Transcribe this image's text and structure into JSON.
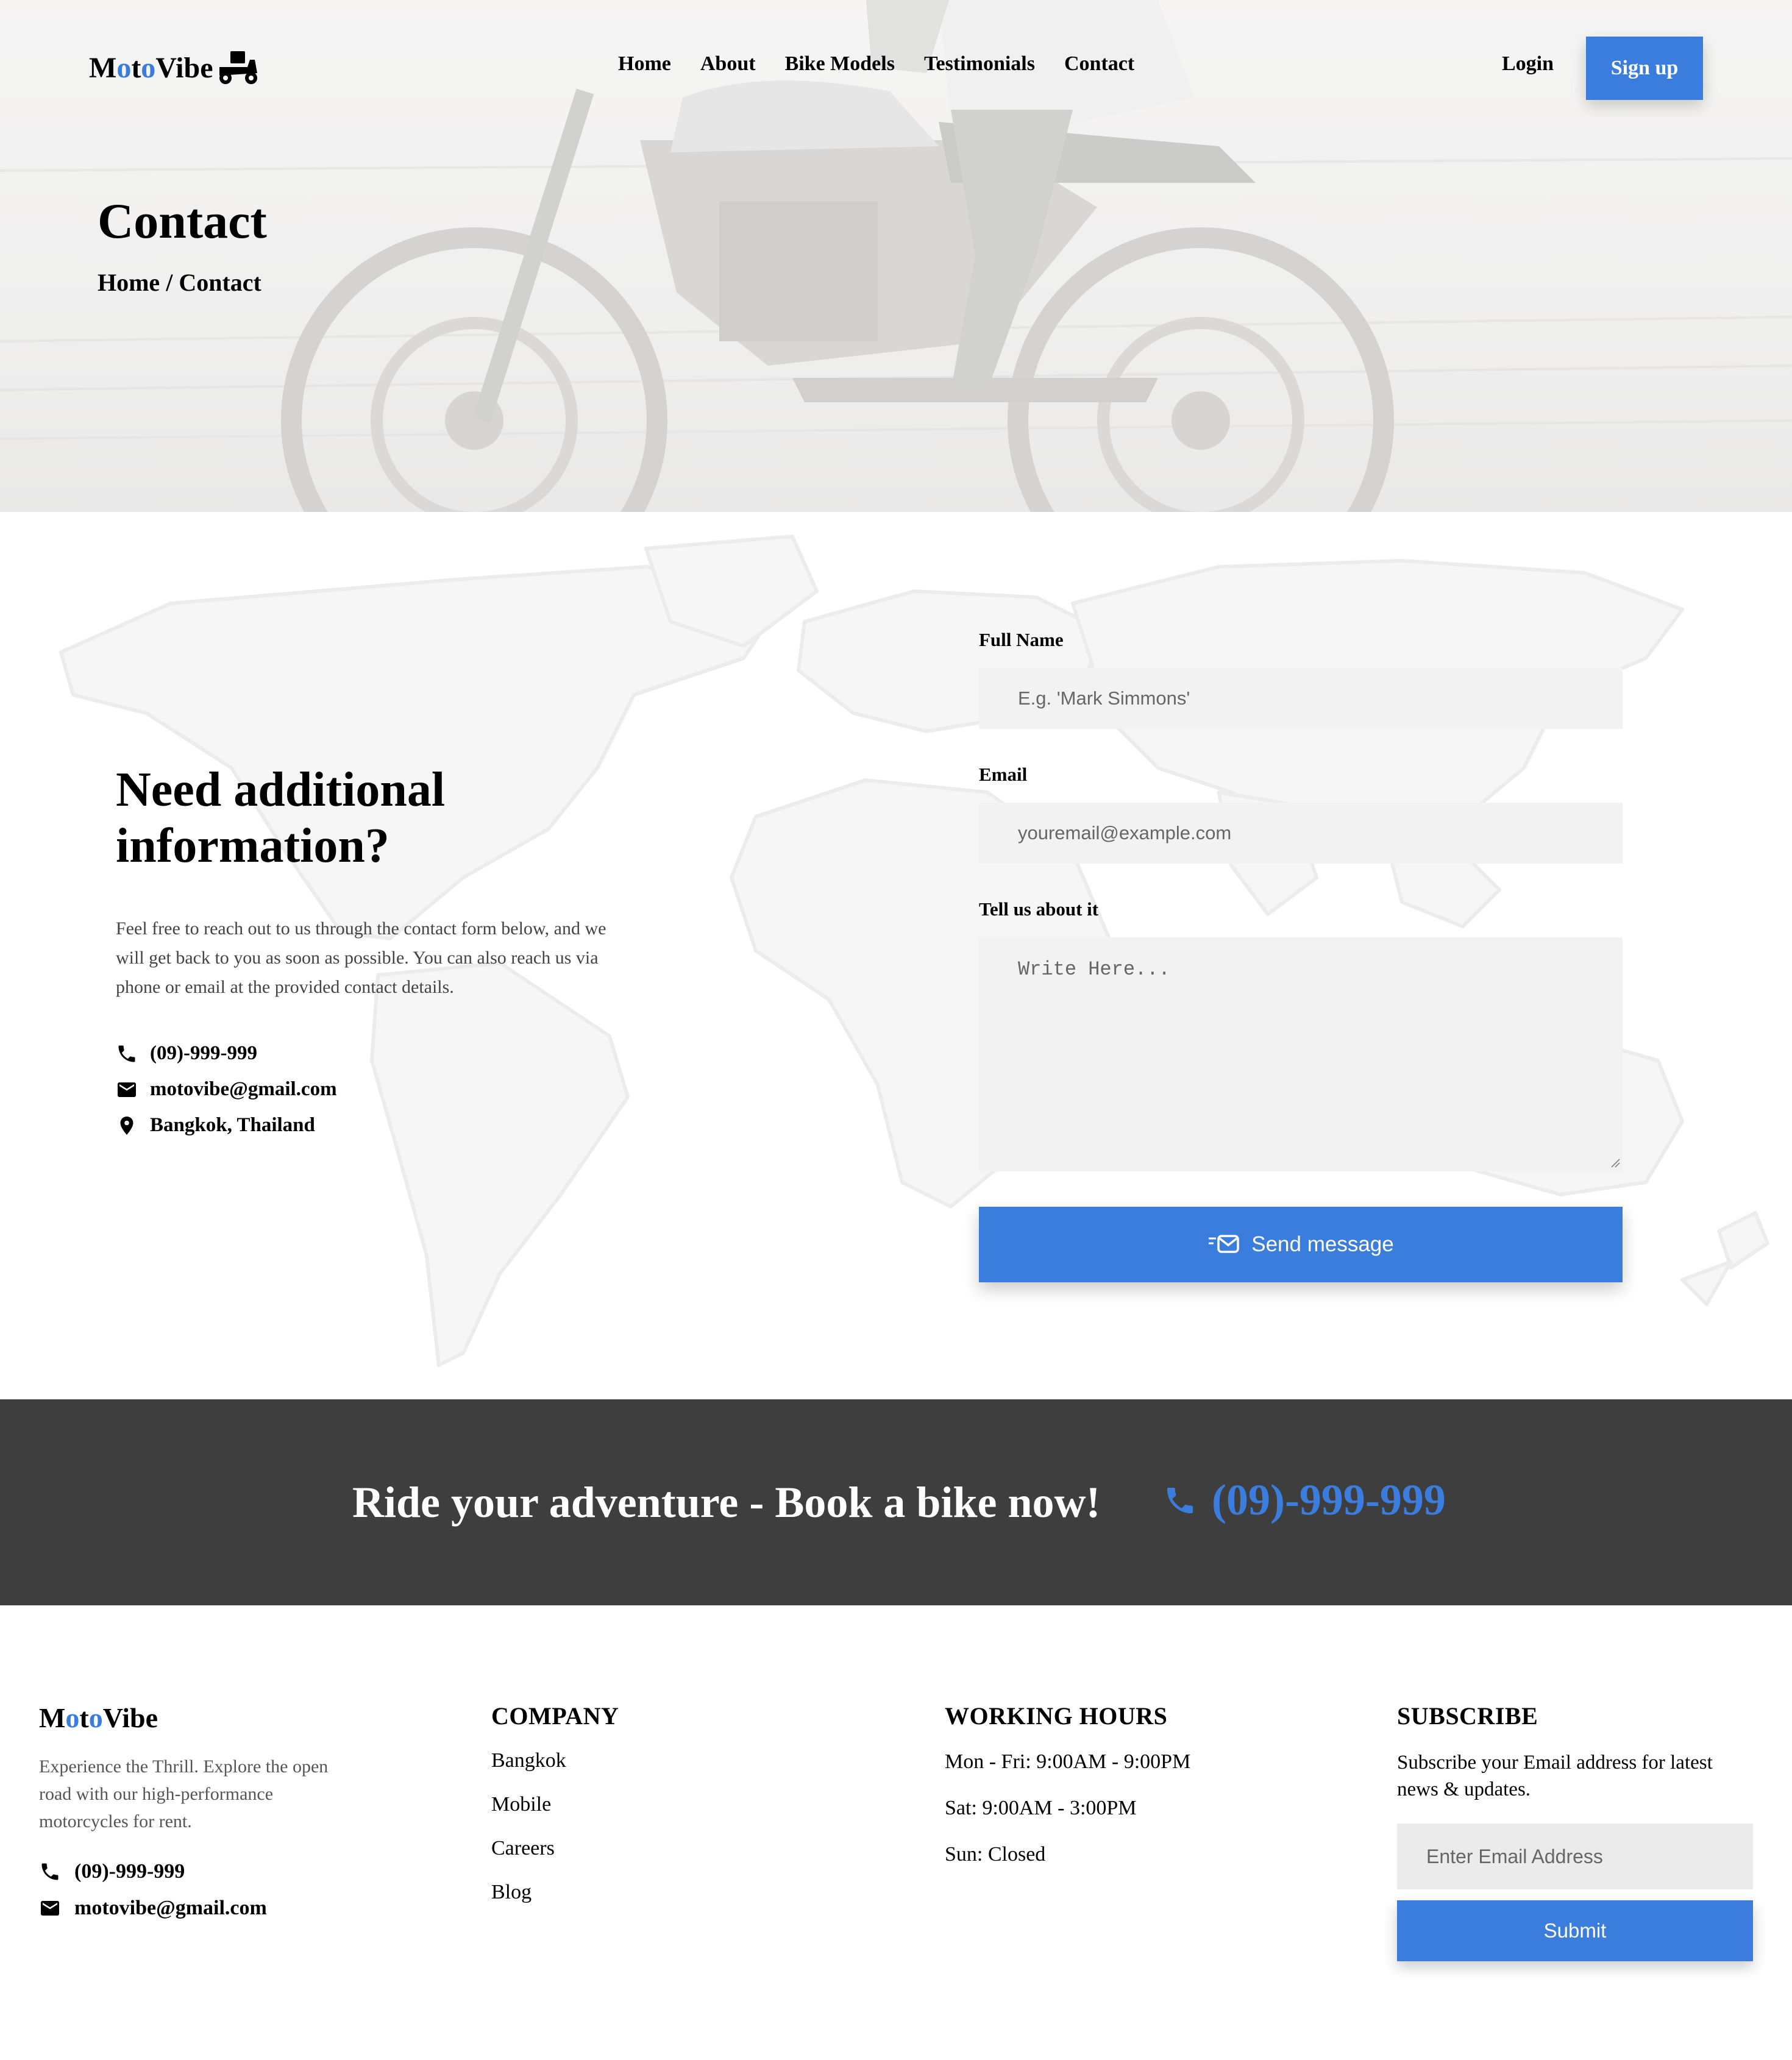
{
  "brand": {
    "part1": "M",
    "part2": "o",
    "part3": "t",
    "part4": "o",
    "part5": "Vibe",
    "accent": "#3b7ddd"
  },
  "nav": {
    "links": [
      "Home",
      "About",
      "Bike Models",
      "Testimonials",
      "Contact"
    ],
    "login": "Login",
    "signup": "Sign up"
  },
  "hero": {
    "title": "Contact",
    "breadcrumb": {
      "home": "Home",
      "sep": "/",
      "current": "Contact"
    }
  },
  "info": {
    "title": "Need additional information?",
    "text": "Feel free to reach out to us through the contact form below, and we will get back to you as soon as possible. You can also reach us via phone or email at the provided contact details.",
    "phone": "(09)-999-999",
    "email": "motovibe@gmail.com",
    "location": "Bangkok, Thailand"
  },
  "form": {
    "name_label": "Full Name",
    "name_placeholder": "E.g. 'Mark Simmons'",
    "email_label": "Email",
    "email_placeholder": "youremail@example.com",
    "message_label": "Tell us about it",
    "message_placeholder": "Write Here...",
    "submit": "Send message"
  },
  "cta": {
    "text": "Ride your adventure - Book a bike now!",
    "phone": "(09)-999-999"
  },
  "footer": {
    "desc": "Experience the Thrill. Explore the open road with our high-performance motorcycles for rent.",
    "phone": "(09)-999-999",
    "email": "motovibe@gmail.com",
    "company_heading": "COMPANY",
    "company_links": [
      "Bangkok",
      "Mobile",
      "Careers",
      "Blog"
    ],
    "hours_heading": "WORKING HOURS",
    "hours": [
      "Mon - Fri: 9:00AM - 9:00PM",
      "Sat: 9:00AM - 3:00PM",
      "Sun: Closed"
    ],
    "subscribe_heading": "SUBSCRIBE",
    "subscribe_text": "Subscribe your Email address for latest news & updates.",
    "subscribe_placeholder": "Enter Email Address",
    "subscribe_button": "Submit"
  }
}
